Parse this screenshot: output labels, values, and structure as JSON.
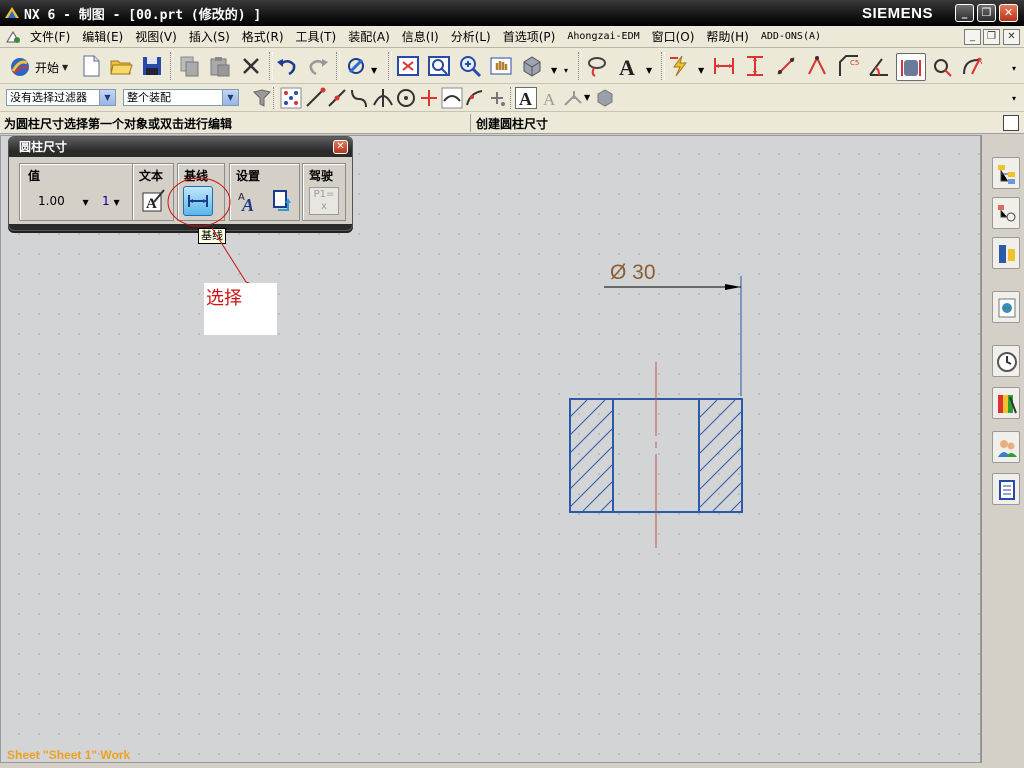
{
  "window": {
    "title": "NX 6 - 制图 - [00.prt (修改的) ]",
    "brand": "SIEMENS",
    "controls": {
      "minimize": "_",
      "restore": "❐",
      "close": "✕"
    }
  },
  "menubar": {
    "items": [
      "文件(F)",
      "编辑(E)",
      "视图(V)",
      "插入(S)",
      "格式(R)",
      "工具(T)",
      "装配(A)",
      "信息(I)",
      "分析(L)",
      "首选项(P)",
      "Ahongzai-EDM",
      "窗口(O)",
      "帮助(H)",
      "ADD-ONS(A)"
    ],
    "mdi_controls": {
      "minimize": "_",
      "restore": "❐",
      "close": "✕"
    }
  },
  "toolbar": {
    "start_label": "开始",
    "filter_value": "没有选择过滤器",
    "scope_value": "整个装配"
  },
  "cue_line": {
    "prompt": "为圆柱尺寸选择第一个对象或双击进行编辑",
    "status": "创建圆柱尺寸"
  },
  "dialog": {
    "title": "圆柱尺寸",
    "groups": {
      "value": {
        "label": "值",
        "nominal": "1.00",
        "tolerance": "1"
      },
      "text": {
        "label": "文本"
      },
      "baseline": {
        "label": "基线"
      },
      "settings": {
        "label": "设置"
      },
      "driving": {
        "label": "驾驶",
        "expression": "P1=",
        "expression_var": "x"
      }
    },
    "tooltip": "基线"
  },
  "annotation": {
    "text": "选择",
    "color": "#d01010"
  },
  "drawing": {
    "dimension_text": "Ø 30",
    "sheet_label": "Sheet \"Sheet 1\" Work",
    "colors": {
      "geometry": "#2a5aa8",
      "centerline": "#c0504d",
      "dimension": "#000000",
      "dimension_text": "#8a6030"
    }
  },
  "resource_bar": {
    "icons": [
      "assembly-navigator-icon",
      "constraint-navigator-icon",
      "part-navigator-icon",
      "web-browser-icon",
      "history-icon",
      "system-visualization-icon",
      "roles-icon",
      "reuse-library-icon"
    ]
  }
}
